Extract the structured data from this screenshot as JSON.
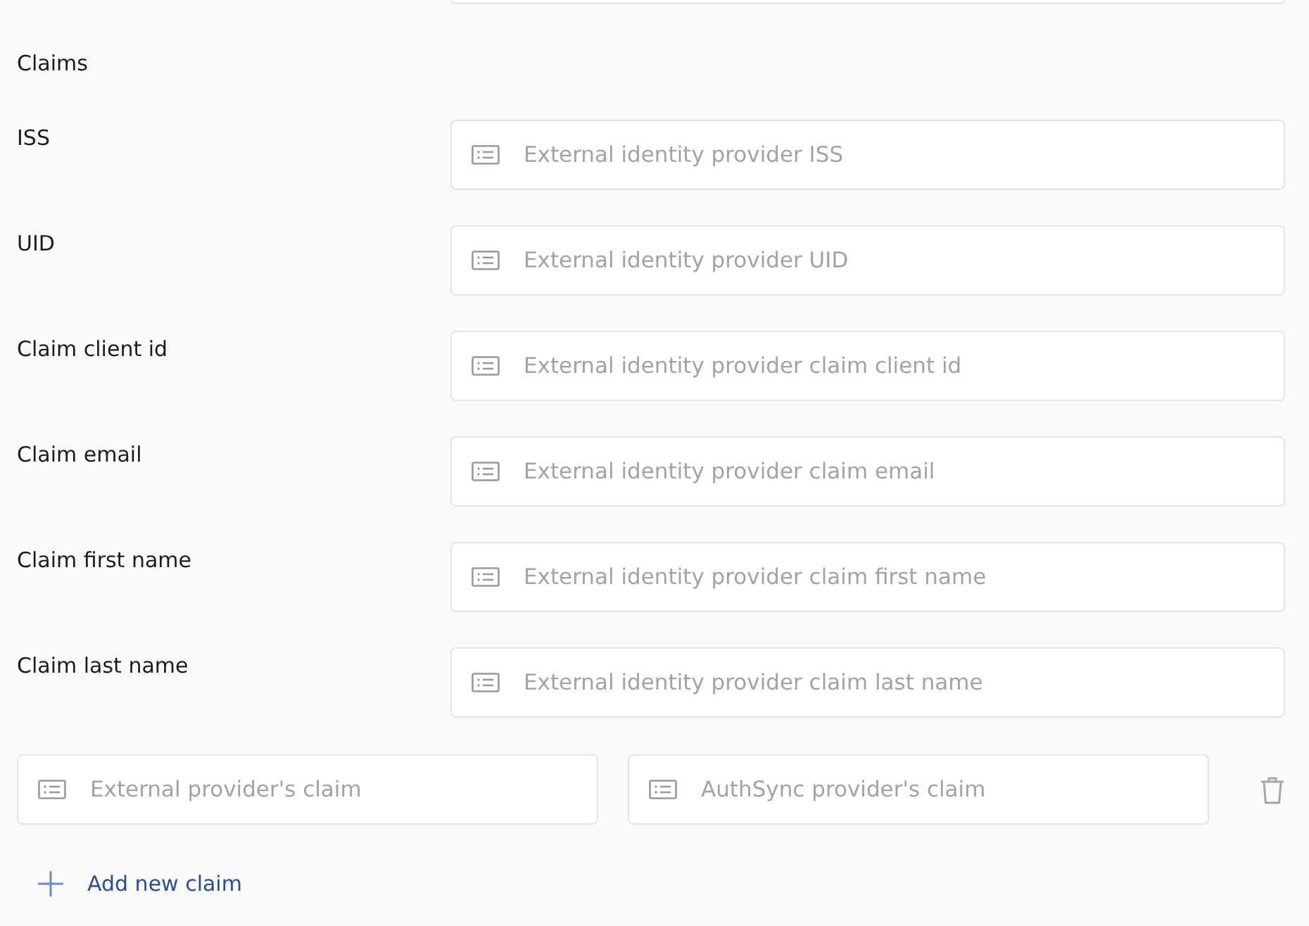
{
  "section_title": "Claims",
  "claims": [
    {
      "label": "ISS",
      "placeholder": "External identity provider ISS"
    },
    {
      "label": "UID",
      "placeholder": "External identity provider UID"
    },
    {
      "label": "Claim client id",
      "placeholder": "External identity provider claim client id"
    },
    {
      "label": "Claim email",
      "placeholder": "External identity provider claim email"
    },
    {
      "label": "Claim first name",
      "placeholder": "External identity provider claim first name"
    },
    {
      "label": "Claim last name",
      "placeholder": "External identity provider claim last name"
    }
  ],
  "mapping_rows": [
    {
      "external_placeholder": "External provider's claim",
      "internal_placeholder": "AuthSync provider's claim"
    }
  ],
  "add_button": {
    "label": "Add new claim"
  }
}
